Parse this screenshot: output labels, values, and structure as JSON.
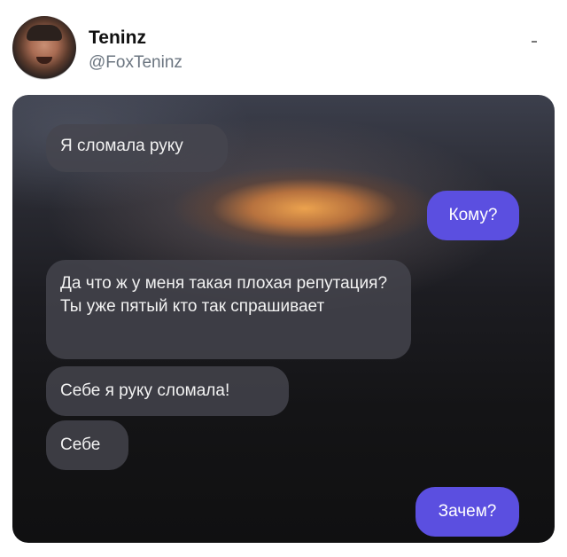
{
  "author": {
    "display_name": "Teninz",
    "handle": "@FoxTeninz"
  },
  "colors": {
    "outgoing_bubble": "#5b4fe0",
    "incoming_bubble": "#46464e",
    "name_text": "#111111",
    "handle_text": "#6b7580"
  },
  "chat": {
    "messages": [
      {
        "side": "incoming",
        "text": "Я сломала руку"
      },
      {
        "side": "outgoing",
        "text": "Кому?"
      },
      {
        "side": "incoming",
        "text": "Да что ж у меня такая плохая репутация? Ты уже пятый кто так спрашивает"
      },
      {
        "side": "incoming",
        "text": "Себе я руку сломала!"
      },
      {
        "side": "incoming",
        "text": "Себе"
      },
      {
        "side": "outgoing",
        "text": "Зачем?"
      }
    ]
  }
}
